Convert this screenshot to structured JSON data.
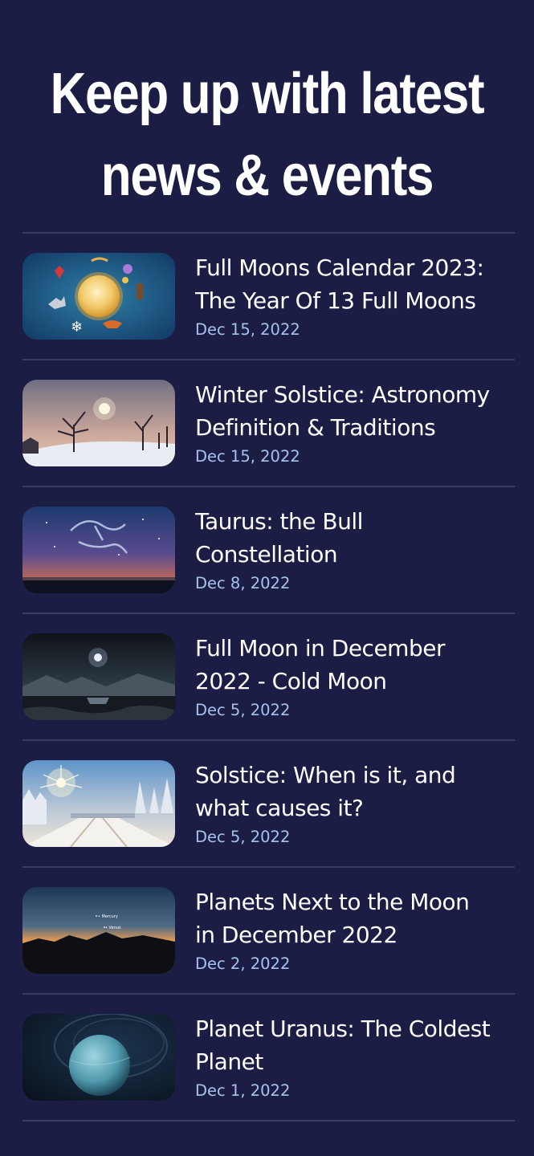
{
  "header": {
    "headline_line1": "Keep up with latest",
    "headline_line2": "news & events"
  },
  "articles": [
    {
      "title_line1": "Full Moons Calendar 2023:",
      "title_line2": "The Year Of 13 Full Moons",
      "date": "Dec 15, 2022",
      "thumbnail": "full-moons-calendar-illustration"
    },
    {
      "title_line1": "Winter Solstice: Astronomy",
      "title_line2": "Definition & Traditions",
      "date": "Dec 15, 2022",
      "thumbnail": "winter-trees-sunset-photo"
    },
    {
      "title_line1": "Taurus: the Bull",
      "title_line2": "Constellation",
      "date": "Dec 8, 2022",
      "thumbnail": "taurus-constellation-photo"
    },
    {
      "title_line1": "Full Moon in December",
      "title_line2": "2022 - Cold Moon",
      "date": "Dec 5, 2022",
      "thumbnail": "moon-over-mountain-lake-photo"
    },
    {
      "title_line1": "Solstice: When is it, and",
      "title_line2": "what causes it?",
      "date": "Dec 5, 2022",
      "thumbnail": "snowy-forest-sun-photo"
    },
    {
      "title_line1": "Planets Next to the Moon",
      "title_line2": "in December 2022",
      "date": "Dec 2, 2022",
      "thumbnail": "twilight-planets-photo"
    },
    {
      "title_line1": "Planet Uranus: The Coldest",
      "title_line2": "Planet",
      "date": "Dec 1, 2022",
      "thumbnail": "planet-uranus-illustration"
    }
  ],
  "thumbnail_labels": {
    "mercury": "• Mercury",
    "venus": "• Venus"
  },
  "colors": {
    "background": "#1c1d45",
    "divider": "#3b3d66",
    "date": "#a6c3ee",
    "text": "#ffffff"
  }
}
